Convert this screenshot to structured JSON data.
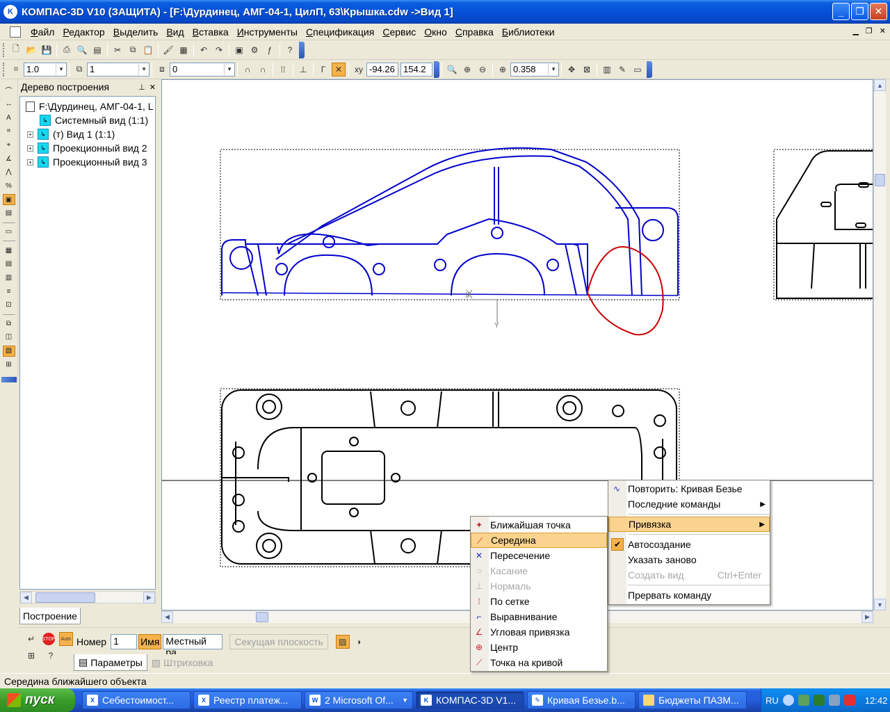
{
  "window": {
    "title": "КОМПАС-3D V10 (ЗАЩИТА) - [F:\\Дурдинец, АМГ-04-1, ЦилП, 63\\Крышка.cdw ->Вид 1]"
  },
  "menubar": [
    "Файл",
    "Редактор",
    "Выделить",
    "Вид",
    "Вставка",
    "Инструменты",
    "Спецификация",
    "Сервис",
    "Окно",
    "Справка",
    "Библиотеки"
  ],
  "toolbar2": {
    "step": "1.0",
    "layer": "1",
    "style": "0",
    "coord_x": "-94.26",
    "coord_y": "154.2",
    "zoom": "0.358"
  },
  "tree": {
    "title": "Дерево построения",
    "root": "F:\\Дурдинец, АМГ-04-1, L",
    "items": [
      "Системный вид (1:1)",
      "(т) Вид 1 (1:1)",
      "Проекционный вид 2",
      "Проекционный вид 3"
    ],
    "tab": "Построение"
  },
  "canvas": {
    "axis_x": "X",
    "axis_y": "Y",
    "colors": {
      "active_view": "#0000CC",
      "curve": "#CC0000",
      "other": "#000000"
    }
  },
  "context_menu": {
    "items": [
      {
        "label": "Повторить: Кривая Безье",
        "icon": "bezier-icon"
      },
      {
        "label": "Последние команды",
        "submenu": true
      },
      {
        "label": "Привязка",
        "submenu": true,
        "highlight": true
      },
      {
        "label": "Автосоздание",
        "checked": true
      },
      {
        "label": "Указать заново"
      },
      {
        "label": "Создать вид",
        "shortcut": "Ctrl+Enter",
        "disabled": true
      },
      {
        "label": "Прервать команду"
      }
    ]
  },
  "snap_menu": {
    "items": [
      {
        "label": "Ближайшая точка",
        "disabled": false
      },
      {
        "label": "Середина",
        "disabled": false,
        "highlight": true
      },
      {
        "label": "Пересечение",
        "disabled": false
      },
      {
        "label": "Касание",
        "disabled": true
      },
      {
        "label": "Нормаль",
        "disabled": true
      },
      {
        "label": "По сетке",
        "disabled": false
      },
      {
        "label": "Выравнивание",
        "disabled": false
      },
      {
        "label": "Угловая привязка",
        "disabled": false
      },
      {
        "label": "Центр",
        "disabled": false
      },
      {
        "label": "Точка на кривой",
        "disabled": false
      }
    ]
  },
  "properties": {
    "number_label": "Номер",
    "number_value": "1",
    "name_label": "Имя",
    "name_value": "Местный ра",
    "cut_plane": "Секущая плоскость",
    "tab_params": "Параметры",
    "tab_hatch": "Штриховка",
    "auto_label": "Auto"
  },
  "status": "Середина ближайшего объекта",
  "taskbar": {
    "start": "пуск",
    "tasks": [
      "Себестоимост...",
      "Реестр платеж...",
      "2 Microsoft Of...",
      "КОМПАС-3D V1...",
      "Кривая Безье.b...",
      "Бюджеты ПАЗМ..."
    ],
    "lang": "RU",
    "time": "12:42"
  }
}
